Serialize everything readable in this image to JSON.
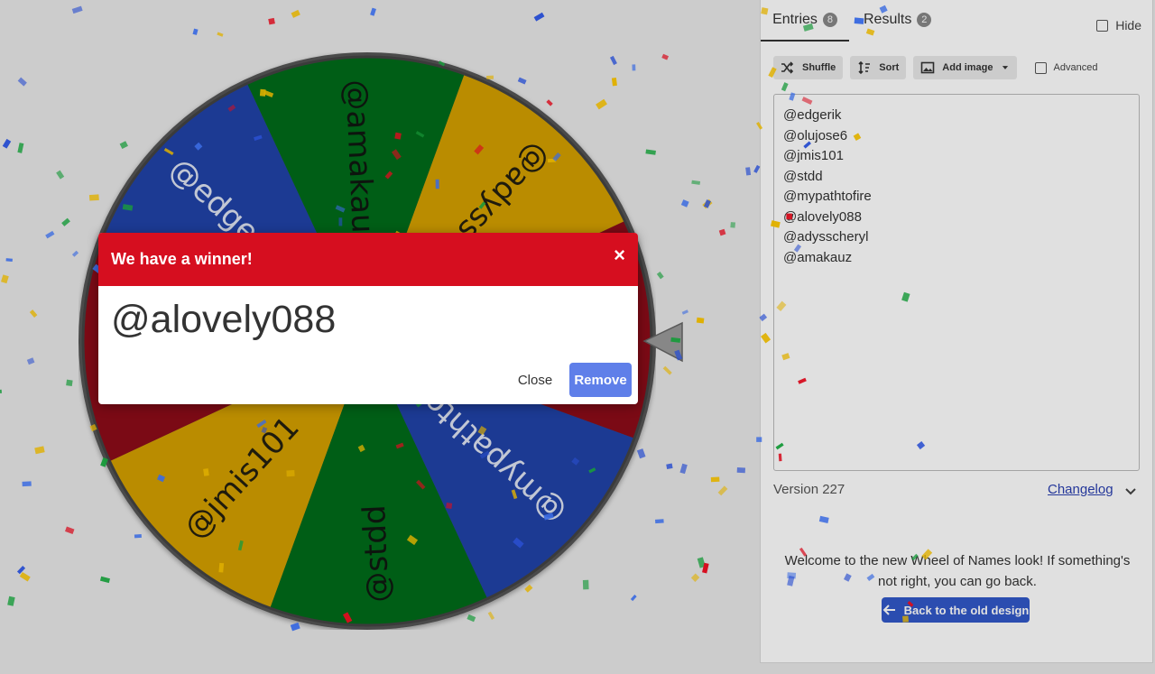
{
  "tabs": [
    {
      "label": "Entries",
      "count": "8"
    },
    {
      "label": "Results",
      "count": "2"
    }
  ],
  "hide_label": "Hide",
  "toolbar": {
    "shuffle": "Shuffle",
    "sort": "Sort",
    "add_image": "Add image",
    "advanced": "Advanced"
  },
  "entries": [
    "@edgerik",
    "@olujose6",
    "@jmis101",
    "@stdd",
    "@mypathtofire",
    "@alovely088",
    "@adysscheryl",
    "@amakauz"
  ],
  "version": "Version 227",
  "changelog": "Changelog",
  "welcome": "Welcome to the new Wheel of Names look! If something's not right, you can go back.",
  "back_button": "Back to the old design",
  "wheel": {
    "colors": {
      "red": "#8c0c18",
      "blue": "#2043a8",
      "green": "#006b1a",
      "yellow": "#d4a000"
    }
  },
  "dialog": {
    "title": "We have a winner!",
    "close_glyph": "×",
    "winner": "@alovely088",
    "close_label": "Close",
    "remove_label": "Remove"
  }
}
